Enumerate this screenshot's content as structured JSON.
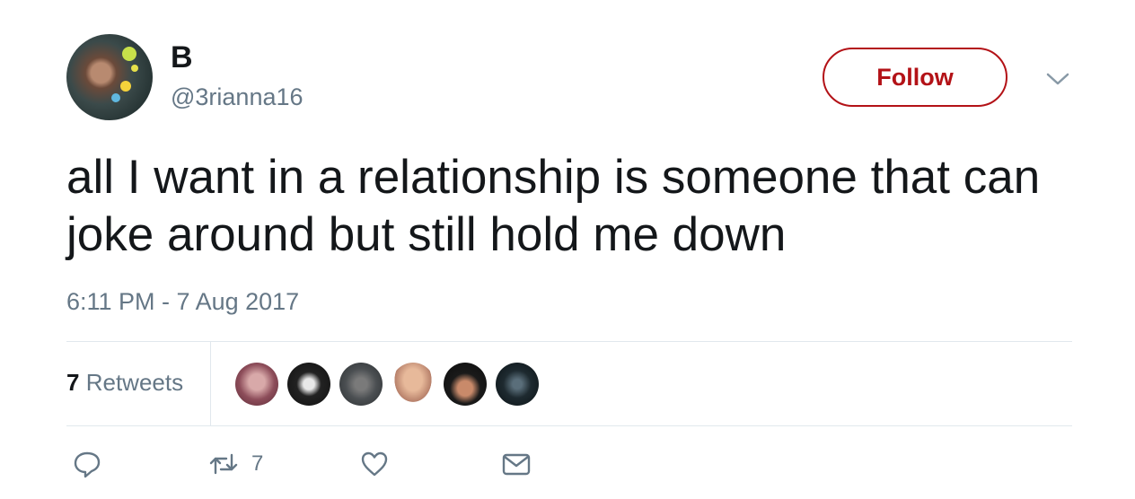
{
  "user": {
    "name": "B",
    "handle": "@3rianna16"
  },
  "follow_button": {
    "label": "Follow"
  },
  "tweet": {
    "text": "all I want in a relationship is someone that can joke around but still hold me down",
    "timestamp": "6:11 PM - 7 Aug 2017"
  },
  "stats": {
    "retweet_count": "7",
    "retweet_label": "Retweets"
  },
  "actions": {
    "retweet_count": "7"
  },
  "colors": {
    "follow_accent": "#b31217",
    "secondary_text": "#657786"
  }
}
